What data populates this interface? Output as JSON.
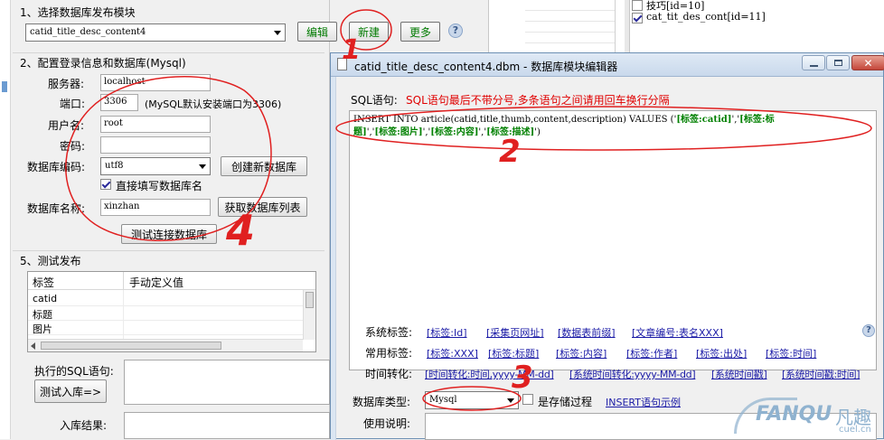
{
  "left_panel": {
    "section1_title": "1、选择数据库发布模块",
    "module_select": "catid_title_desc_content4",
    "edit_btn": "编辑",
    "new_btn": "新建",
    "more_btn": "更多",
    "section2_title": "2、配置登录信息和数据库(Mysql)",
    "server_label": "服务器:",
    "server_value": "localhost",
    "port_label": "端口:",
    "port_value": "3306",
    "port_note": "(MySQL默认安装端口为3306)",
    "user_label": "用户名:",
    "user_value": "root",
    "pwd_label": "密码:",
    "encoding_label": "数据库编码:",
    "encoding_value": "utf8",
    "create_db_btn": "创建新数据库",
    "direct_db_label": "直接填写数据库名",
    "dbname_label": "数据库名称:",
    "dbname_value": "xinzhan",
    "get_db_list_btn": "获取数据库列表",
    "test_conn_btn": "测试连接数据库",
    "section5_title": "5、测试发布",
    "col_tag": "标签",
    "col_value": "手动定义值",
    "rows": [
      "catid",
      "标题",
      "图片"
    ],
    "sql_exec_label": "执行的SQL语句:",
    "test_insert_btn": "测试入库=>",
    "result_label": "入库结果:"
  },
  "background_right": {
    "items": [
      {
        "label": "技巧[id=10]",
        "checked": false
      },
      {
        "label": "cat_tit_des_cont[id=11]",
        "checked": true
      }
    ]
  },
  "dialog": {
    "title": "catid_title_desc_content4.dbm - 数据库模块编辑器",
    "sql_label": "SQL语句:",
    "sql_hint": "SQL语句最后不带分号,多条语句之间请用回车换行分隔",
    "sql_line1_plain": "INSERT INTO article(catid,title,thumb,content,description) VALUES ('",
    "sql_line1_tag1": "[标签:catid]",
    "sql_line1_mid": "','",
    "sql_line1_tag2": "[标签:标",
    "sql_line2_tag2b": "题]",
    "sql_line2_sep1": "','",
    "sql_line2_tag3": "[标签:图片]",
    "sql_line2_sep2": "','",
    "sql_line2_tag4": "[标签:内容]",
    "sql_line2_sep3": "','",
    "sql_line2_tag5": "[标签:描述]",
    "sql_line2_end": "')",
    "sys_tags_label": "系统标签:",
    "sys_tags": [
      "[标签:Id]",
      "[采集页网址]",
      "[数据表前缀]",
      "[文章编号:表名XXX]"
    ],
    "common_tags_label": "常用标签:",
    "common_tags": [
      "[标签:XXX]",
      "[标签:标题]",
      "[标签:内容]",
      "[标签:作者]",
      "[标签:出处]",
      "[标签:时间]"
    ],
    "time_label": "时间转化:",
    "time_tags": [
      "[时间转化:时间,yyyy-MM-dd]",
      "[系统时间转化:yyyy-MM-dd]",
      "[系统时间戳]",
      "[系统时间戳:时间]"
    ],
    "db_type_label": "数据库类型:",
    "db_type_value": "Mysql",
    "stored_proc_label": "是存储过程",
    "insert_example": "INSERT语句示例",
    "usage_label": "使用说明:"
  },
  "annotations": {
    "n1": "1",
    "n2": "2",
    "n3": "3",
    "n4": "4"
  },
  "watermark": {
    "brand": "FANQU",
    "cn": "凡趣",
    "site": "cuel.cn"
  }
}
